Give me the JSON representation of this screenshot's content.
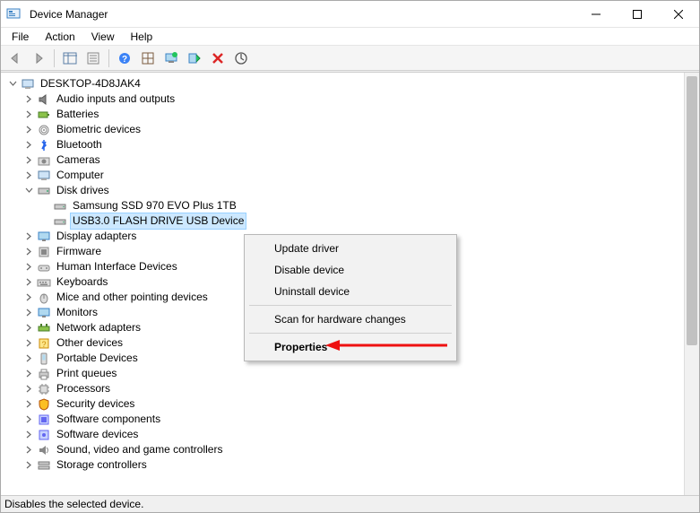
{
  "window": {
    "title": "Device Manager"
  },
  "menubar": {
    "items": [
      "File",
      "Action",
      "View",
      "Help"
    ]
  },
  "toolbar": {
    "back": "Back",
    "forward": "Forward",
    "show_hidden": "Show/Hide Console Tree",
    "properties": "Properties",
    "help": "Help",
    "grid_icon": "Grid",
    "monitor_icon": "Monitor",
    "add_icon": "Add",
    "delete_icon": "Delete",
    "scan_icon": "Scan"
  },
  "tree": {
    "root": {
      "label": "DESKTOP-4D8JAK4"
    },
    "categories": [
      {
        "label": "Audio inputs and outputs",
        "expanded": false
      },
      {
        "label": "Batteries",
        "expanded": false
      },
      {
        "label": "Biometric devices",
        "expanded": false
      },
      {
        "label": "Bluetooth",
        "expanded": false
      },
      {
        "label": "Cameras",
        "expanded": false
      },
      {
        "label": "Computer",
        "expanded": false
      },
      {
        "label": "Disk drives",
        "expanded": true,
        "children": [
          {
            "label": "Samsung SSD 970 EVO Plus 1TB"
          },
          {
            "label": "USB3.0 FLASH DRIVE USB Device",
            "selected": true
          }
        ]
      },
      {
        "label": "Display adapters",
        "expanded": false
      },
      {
        "label": "Firmware",
        "expanded": false
      },
      {
        "label": "Human Interface Devices",
        "expanded": false
      },
      {
        "label": "Keyboards",
        "expanded": false
      },
      {
        "label": "Mice and other pointing devices",
        "expanded": false
      },
      {
        "label": "Monitors",
        "expanded": false
      },
      {
        "label": "Network adapters",
        "expanded": false
      },
      {
        "label": "Other devices",
        "expanded": false
      },
      {
        "label": "Portable Devices",
        "expanded": false
      },
      {
        "label": "Print queues",
        "expanded": false
      },
      {
        "label": "Processors",
        "expanded": false
      },
      {
        "label": "Security devices",
        "expanded": false
      },
      {
        "label": "Software components",
        "expanded": false
      },
      {
        "label": "Software devices",
        "expanded": false
      },
      {
        "label": "Sound, video and game controllers",
        "expanded": false
      },
      {
        "label": "Storage controllers",
        "expanded": false
      }
    ]
  },
  "context_menu": {
    "items": [
      {
        "label": "Update driver",
        "type": "item"
      },
      {
        "label": "Disable device",
        "type": "item"
      },
      {
        "label": "Uninstall device",
        "type": "item"
      },
      {
        "type": "separator"
      },
      {
        "label": "Scan for hardware changes",
        "type": "item"
      },
      {
        "type": "separator"
      },
      {
        "label": "Properties",
        "type": "item",
        "default": true
      }
    ]
  },
  "statusbar": {
    "text": "Disables the selected device."
  }
}
